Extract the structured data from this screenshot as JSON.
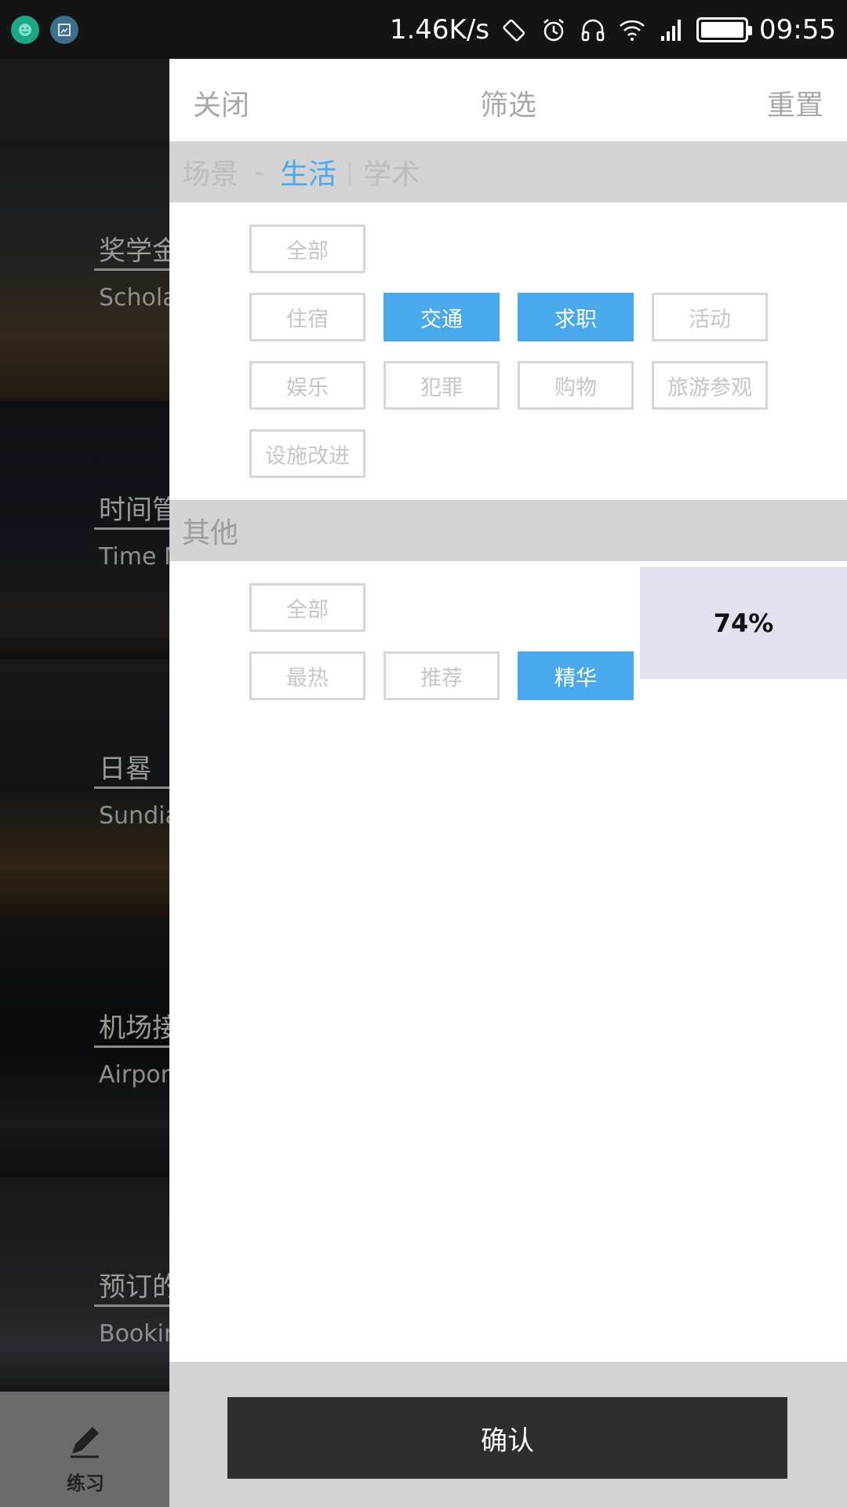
{
  "status_bar": {
    "net_speed": "1.46K/s",
    "time": "09:55",
    "icons": [
      "app-notification-icon",
      "screenshot-icon",
      "rotate-icon",
      "alarm-icon",
      "headphones-icon",
      "wifi-icon",
      "signal-icon",
      "battery-icon"
    ]
  },
  "background_list": {
    "items": [
      {
        "title": "奖学金",
        "subtitle": "Scholarship"
      },
      {
        "title": "时间管理",
        "subtitle": "Time Management"
      },
      {
        "title": "日晷",
        "subtitle": "Sundial"
      },
      {
        "title": "机场接机",
        "subtitle": "Airport Pickup"
      },
      {
        "title": "预订的",
        "subtitle": "Booking"
      }
    ],
    "bottom_nav_label": "练习"
  },
  "drawer": {
    "close_label": "关闭",
    "title": "筛选",
    "reset_label": "重置",
    "scene_section": {
      "label": "场景",
      "dash": "-",
      "active_tab": "生活",
      "separator": "|",
      "other_tab": "学术"
    },
    "scene_tags": [
      {
        "label": "全部",
        "selected": false
      },
      {
        "label": "住宿",
        "selected": false
      },
      {
        "label": "交通",
        "selected": true
      },
      {
        "label": "求职",
        "selected": true
      },
      {
        "label": "活动",
        "selected": false
      },
      {
        "label": "娱乐",
        "selected": false
      },
      {
        "label": "犯罪",
        "selected": false
      },
      {
        "label": "购物",
        "selected": false
      },
      {
        "label": "旅游参观",
        "selected": false
      },
      {
        "label": "设施改进",
        "selected": false
      }
    ],
    "other_section": {
      "label": "其他"
    },
    "other_tags": [
      {
        "label": "全部",
        "selected": false
      },
      {
        "label": "最热",
        "selected": false
      },
      {
        "label": "推荐",
        "selected": false
      },
      {
        "label": "精华",
        "selected": true
      }
    ],
    "progress_text": "74%",
    "confirm_label": "确认"
  },
  "colors": {
    "accent": "#4aa8ec",
    "section_bg": "#d3d3d3",
    "confirm_bg": "#2e2e2e",
    "progress_bg": "#e3e0f2"
  }
}
